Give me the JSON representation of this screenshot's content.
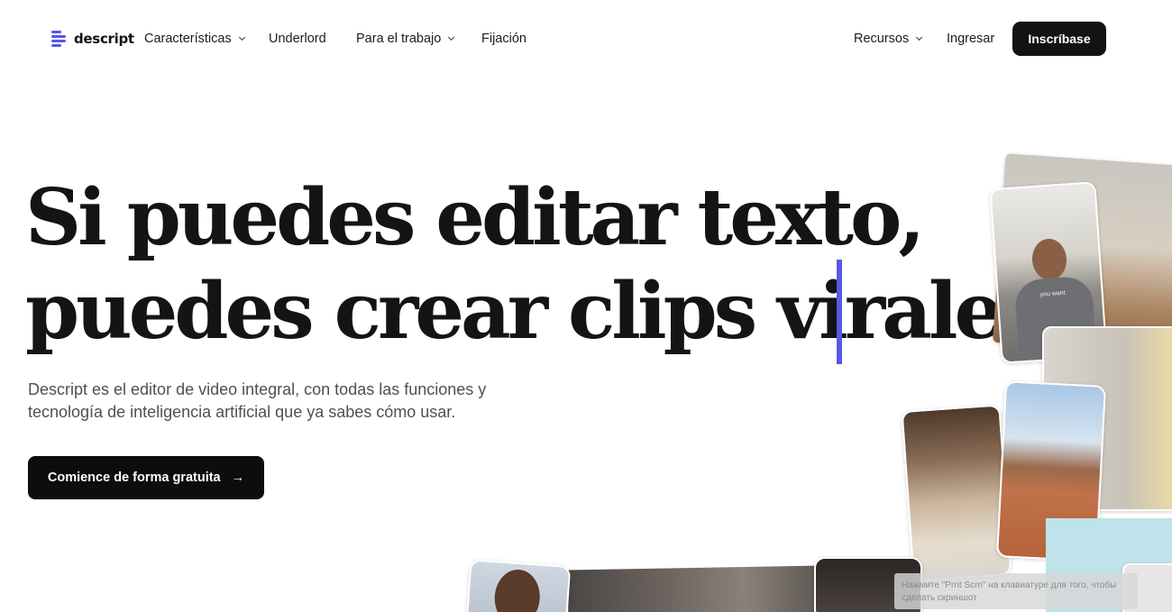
{
  "brand": {
    "name": "descript",
    "accent": "#5a57e6"
  },
  "nav": {
    "items": [
      {
        "label": "Características",
        "has_dropdown": true
      },
      {
        "label": "Underlord",
        "has_dropdown": false
      },
      {
        "label": "Para el trabajo",
        "has_dropdown": true
      },
      {
        "label": "Fijación",
        "has_dropdown": false
      }
    ],
    "resources": {
      "label": "Recursos",
      "has_dropdown": true
    },
    "login_label": "Ingresar",
    "signup_label": "Inscríbase"
  },
  "hero": {
    "headline_line1": "Si puedes editar texto,",
    "headline_line2": "puedes crear clips virales.",
    "subtitle": "Descript es el editor de video integral, con todas las funciones y tecnología de inteligencia artificial que ya sabes cómo usar.",
    "cta_label": "Comience de forma gratuita",
    "cta_icon": "arrow-right-icon"
  },
  "collage": {
    "shirt_text": "you want"
  },
  "system_tooltip": {
    "text": "Нажмите \"Prnt Scrn\" на клавиатуре для того, чтобы сделать скриншот"
  }
}
